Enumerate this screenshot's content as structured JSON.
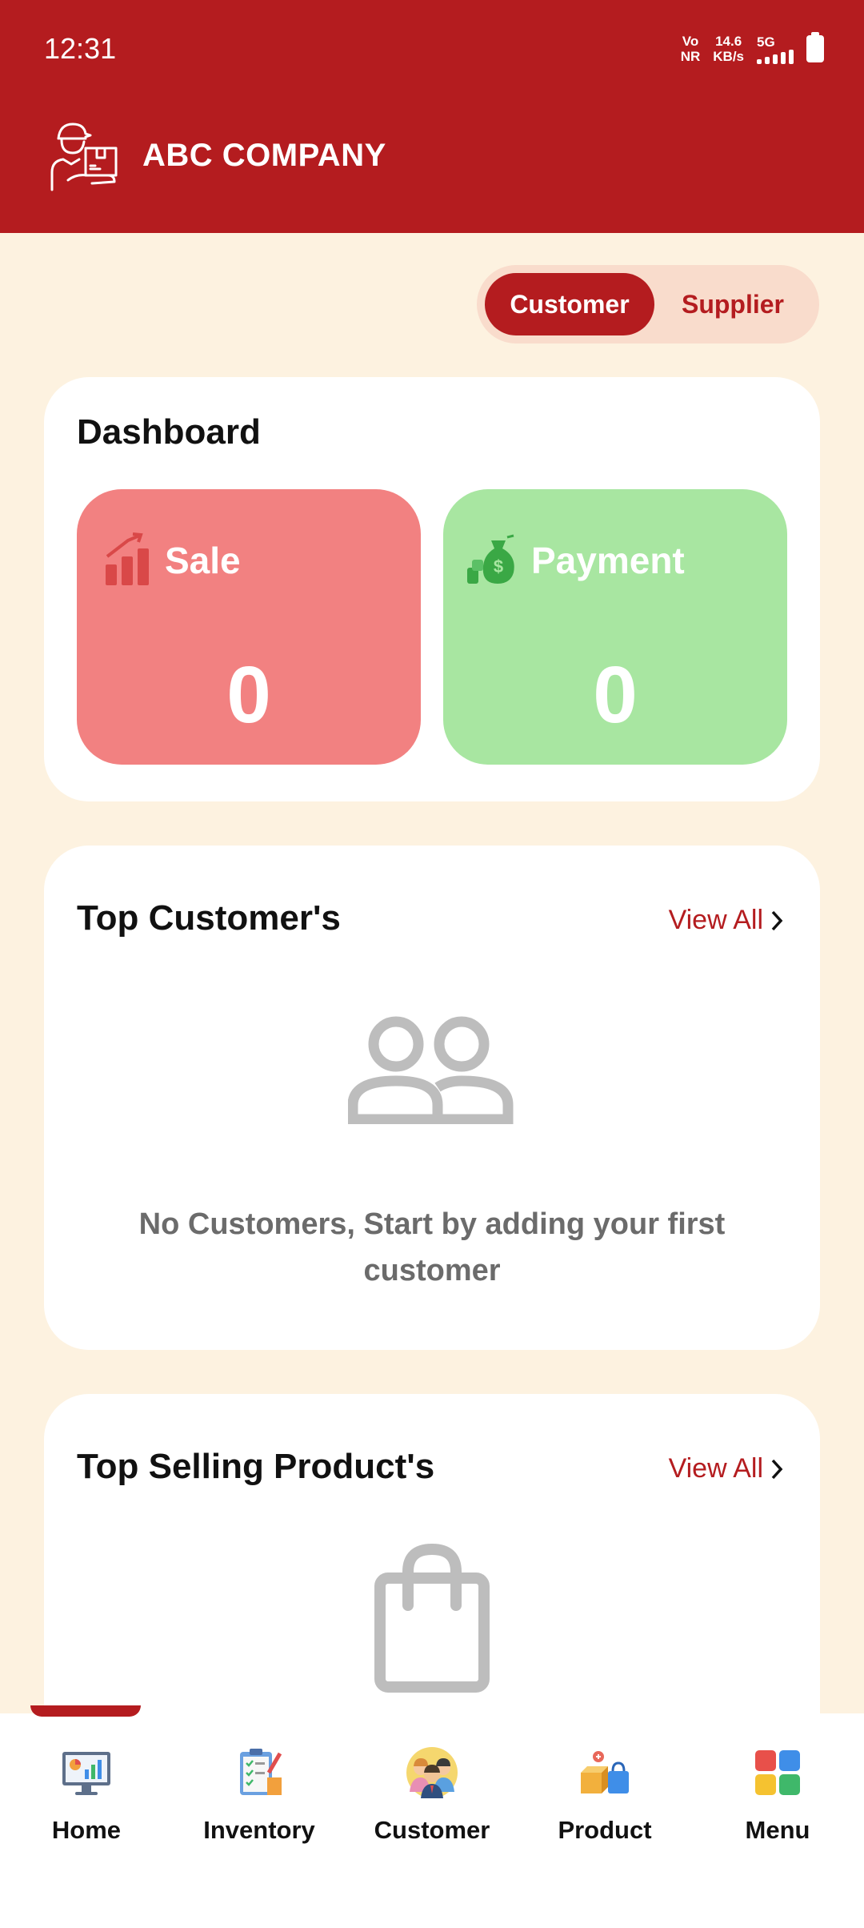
{
  "status": {
    "time": "12:31",
    "net_line1": "Vo",
    "net_line2": "NR",
    "speed_line1": "14.6",
    "speed_line2": "KB/s",
    "network": "5G"
  },
  "header": {
    "company": "ABC COMPANY",
    "logo_icon": "delivery-person-icon"
  },
  "toggle": {
    "active": "Customer",
    "inactive": "Supplier"
  },
  "dashboard": {
    "title": "Dashboard",
    "sale": {
      "label": "Sale",
      "value": "0",
      "icon": "bar-chart-up-icon",
      "color": "#f28181"
    },
    "payment": {
      "label": "Payment",
      "value": "0",
      "icon": "money-bag-icon",
      "color": "#a8e6a1"
    }
  },
  "top_customers": {
    "title": "Top Customer's",
    "view_all": "View All",
    "empty_icon": "users-icon",
    "empty_text": "No Customers, Start by adding your first customer"
  },
  "top_products": {
    "title": "Top Selling Product's",
    "view_all": "View All",
    "empty_icon": "shopping-bag-icon"
  },
  "nav": [
    {
      "label": "Home",
      "icon": "home-monitor-icon"
    },
    {
      "label": "Inventory",
      "icon": "clipboard-checklist-icon"
    },
    {
      "label": "Customer",
      "icon": "people-group-icon"
    },
    {
      "label": "Product",
      "icon": "box-bag-icon"
    },
    {
      "label": "Menu",
      "icon": "grid-menu-icon"
    }
  ],
  "colors": {
    "primary": "#b41c1f",
    "background": "#fdf2e0",
    "toggle_bg": "#f9dccc"
  }
}
